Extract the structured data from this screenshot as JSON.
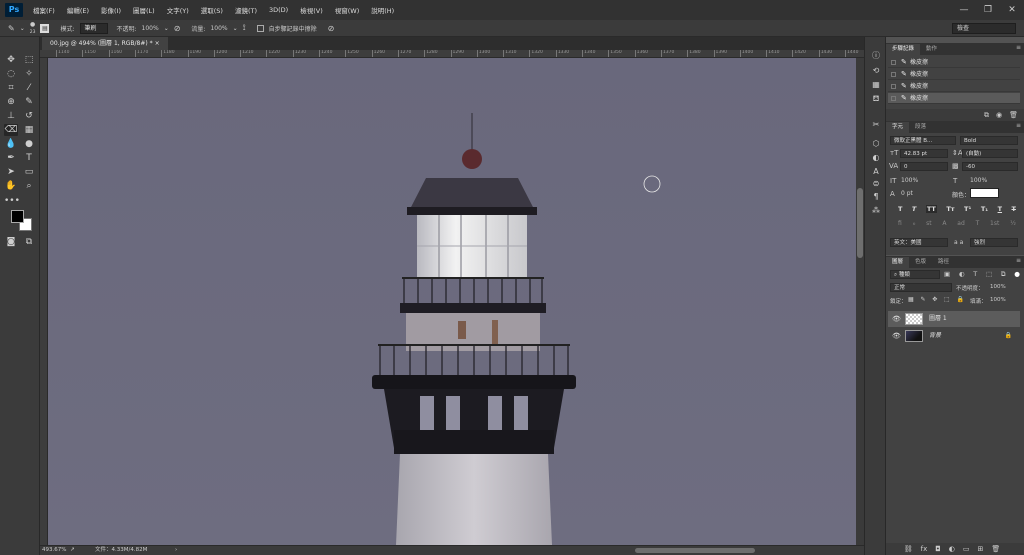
{
  "app": {
    "logo": "Ps"
  },
  "menu": [
    "檔案(F)",
    "編輯(E)",
    "影像(I)",
    "圖層(L)",
    "文字(Y)",
    "選取(S)",
    "濾鏡(T)",
    "3D(D)",
    "檢視(V)",
    "視窗(W)",
    "說明(H)"
  ],
  "window_controls": [
    "—",
    "❐",
    "✕"
  ],
  "options": {
    "brush_size": "23",
    "mode_label": "模式:",
    "mode_value": "筆刷",
    "opacity_label": "不透明:",
    "opacity_value": "100%",
    "flow_label": "流量:",
    "flow_value": "100%",
    "erase_history": "自步驟記錄中擦除",
    "workspace": "檢查"
  },
  "document": {
    "tab_title": "00.jpg @ 494% (圖層 1, RGB/8#) *",
    "tab_close": "×",
    "zoom": "493.67%",
    "file_info": "文件：4.33M/4.82M"
  },
  "ruler_ticks": [
    "1140",
    "1150",
    "1160",
    "1170",
    "1180",
    "1190",
    "1200",
    "1210",
    "1220",
    "1230",
    "1240",
    "1250",
    "1260",
    "1270",
    "1280",
    "1290",
    "1300",
    "1310",
    "1320",
    "1330",
    "1340",
    "1350",
    "1360",
    "1370",
    "1380",
    "1390",
    "1400",
    "1410",
    "1420",
    "1430",
    "1440"
  ],
  "history": {
    "tabs": [
      "步驟記錄",
      "動作"
    ],
    "rows": [
      "橡皮擦",
      "橡皮擦",
      "橡皮擦",
      "橡皮擦"
    ],
    "selected_index": 3
  },
  "character": {
    "tabs": [
      "字元",
      "段落"
    ],
    "font_family": "微軟正黑體 B...",
    "font_style": "Bold",
    "font_size": "42.83 pt",
    "leading": "(自動)",
    "kerning": "0",
    "tracking": "-60",
    "vscale": "100%",
    "hscale": "100%",
    "baseline": "0 pt",
    "color_label": "顏色：",
    "language": "英文：美國",
    "aa_label": "a a",
    "aa_value": "強烈",
    "style_buttons": [
      "T",
      "T",
      "TT",
      "Tт",
      "T¹",
      "T₁",
      "T",
      "T"
    ],
    "ot_buttons": [
      "fi",
      "ℴ",
      "st",
      "A",
      "ad",
      "T",
      "1st",
      "½"
    ]
  },
  "layers": {
    "tabs": [
      "圖層",
      "色版",
      "路徑"
    ],
    "kind": "種類",
    "blend": "正常",
    "opacity_label": "不透明度：",
    "opacity": "100%",
    "lock_label": "鎖定：",
    "fill_label": "填滿：",
    "fill": "100%",
    "items": [
      {
        "name": "圖層 1",
        "selected": true
      },
      {
        "name": "背景",
        "selected": false
      }
    ]
  }
}
